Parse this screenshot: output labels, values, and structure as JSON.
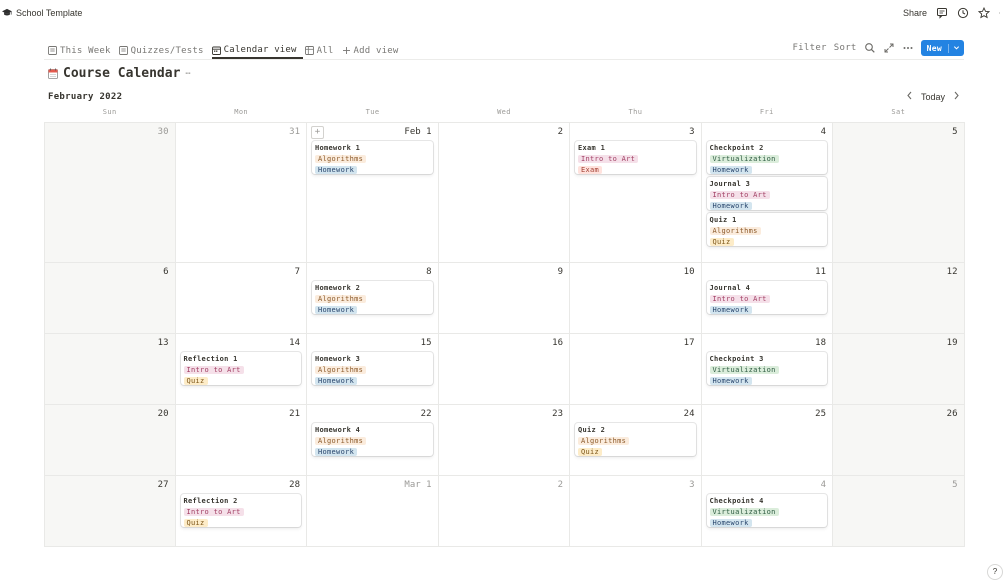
{
  "app": {
    "page_title": "School Template",
    "share_label": "Share"
  },
  "tabs": [
    {
      "label": "This Week",
      "icon": "page-icon",
      "active": false
    },
    {
      "label": "Quizzes/Tests",
      "icon": "page-icon",
      "active": false
    },
    {
      "label": "Calendar view",
      "icon": "calendar-icon",
      "active": true
    },
    {
      "label": "All",
      "icon": "table-icon",
      "active": false
    },
    {
      "label": "Add view",
      "icon": "plus-icon",
      "active": false
    }
  ],
  "view_actions": {
    "filter": "Filter",
    "sort": "Sort",
    "new": "New"
  },
  "calendar": {
    "title": "Course Calendar",
    "month_label": "February 2022",
    "today_label": "Today",
    "weekdays": [
      "Sun",
      "Mon",
      "Tue",
      "Wed",
      "Thu",
      "Fri",
      "Sat"
    ],
    "weeks": [
      [
        {
          "label": "30",
          "out": true,
          "weekend": true,
          "cards": []
        },
        {
          "label": "31",
          "out": true,
          "cards": []
        },
        {
          "label": "Feb 1",
          "plus": true,
          "cards": [
            {
              "title": "Homework 1",
              "tags": [
                "Algorithms",
                "Homework"
              ]
            }
          ]
        },
        {
          "label": "2",
          "cards": []
        },
        {
          "label": "3",
          "cards": [
            {
              "title": "Exam 1",
              "tags": [
                "Intro to Art",
                "Exam"
              ]
            }
          ]
        },
        {
          "label": "4",
          "cards": [
            {
              "title": "Checkpoint 2",
              "tags": [
                "Virtualization",
                "Homework"
              ]
            },
            {
              "title": "Journal 3",
              "tags": [
                "Intro to Art",
                "Homework"
              ]
            },
            {
              "title": "Quiz 1",
              "tags": [
                "Algorithms",
                "Quiz"
              ]
            }
          ]
        },
        {
          "label": "5",
          "weekend": true,
          "cards": []
        }
      ],
      [
        {
          "label": "6",
          "weekend": true,
          "cards": []
        },
        {
          "label": "7",
          "cards": []
        },
        {
          "label": "8",
          "cards": [
            {
              "title": "Homework 2",
              "tags": [
                "Algorithms",
                "Homework"
              ]
            }
          ]
        },
        {
          "label": "9",
          "cards": []
        },
        {
          "label": "10",
          "cards": []
        },
        {
          "label": "11",
          "cards": [
            {
              "title": "Journal 4",
              "tags": [
                "Intro to Art",
                "Homework"
              ]
            }
          ]
        },
        {
          "label": "12",
          "weekend": true,
          "cards": []
        }
      ],
      [
        {
          "label": "13",
          "weekend": true,
          "cards": []
        },
        {
          "label": "14",
          "cards": [
            {
              "title": "Reflection 1",
              "tags": [
                "Intro to Art",
                "Quiz"
              ]
            }
          ]
        },
        {
          "label": "15",
          "cards": [
            {
              "title": "Homework 3",
              "tags": [
                "Algorithms",
                "Homework"
              ]
            }
          ]
        },
        {
          "label": "16",
          "cards": []
        },
        {
          "label": "17",
          "cards": []
        },
        {
          "label": "18",
          "cards": [
            {
              "title": "Checkpoint 3",
              "tags": [
                "Virtualization",
                "Homework"
              ]
            }
          ]
        },
        {
          "label": "19",
          "weekend": true,
          "cards": []
        }
      ],
      [
        {
          "label": "20",
          "weekend": true,
          "cards": []
        },
        {
          "label": "21",
          "cards": []
        },
        {
          "label": "22",
          "cards": [
            {
              "title": "Homework 4",
              "tags": [
                "Algorithms",
                "Homework"
              ]
            }
          ]
        },
        {
          "label": "23",
          "cards": []
        },
        {
          "label": "24",
          "cards": [
            {
              "title": "Quiz 2",
              "tags": [
                "Algorithms",
                "Quiz"
              ]
            }
          ]
        },
        {
          "label": "25",
          "cards": []
        },
        {
          "label": "26",
          "weekend": true,
          "cards": []
        }
      ],
      [
        {
          "label": "27",
          "weekend": true,
          "cards": []
        },
        {
          "label": "28",
          "cards": [
            {
              "title": "Reflection 2",
              "tags": [
                "Intro to Art",
                "Quiz"
              ]
            }
          ]
        },
        {
          "label": "Mar 1",
          "out": true,
          "cards": []
        },
        {
          "label": "2",
          "out": true,
          "cards": []
        },
        {
          "label": "3",
          "out": true,
          "cards": []
        },
        {
          "label": "4",
          "out": true,
          "cards": [
            {
              "title": "Checkpoint 4",
              "tags": [
                "Virtualization",
                "Homework"
              ]
            }
          ]
        },
        {
          "label": "5",
          "out": true,
          "weekend": true,
          "cards": []
        }
      ]
    ]
  },
  "tag_colors": {
    "Algorithms": {
      "bg": "#fbecdd",
      "fg": "#8c5a2a"
    },
    "Homework": {
      "bg": "#d3e5ef",
      "fg": "#28456c"
    },
    "Intro to Art": {
      "bg": "#f5e0e9",
      "fg": "#a13f64"
    },
    "Exam": {
      "bg": "#ffe2dd",
      "fg": "#a13f32"
    },
    "Virtualization": {
      "bg": "#dbeddb",
      "fg": "#2b593f"
    },
    "Quiz": {
      "bg": "#fdecc8",
      "fg": "#7b5416"
    }
  },
  "help_label": "?"
}
